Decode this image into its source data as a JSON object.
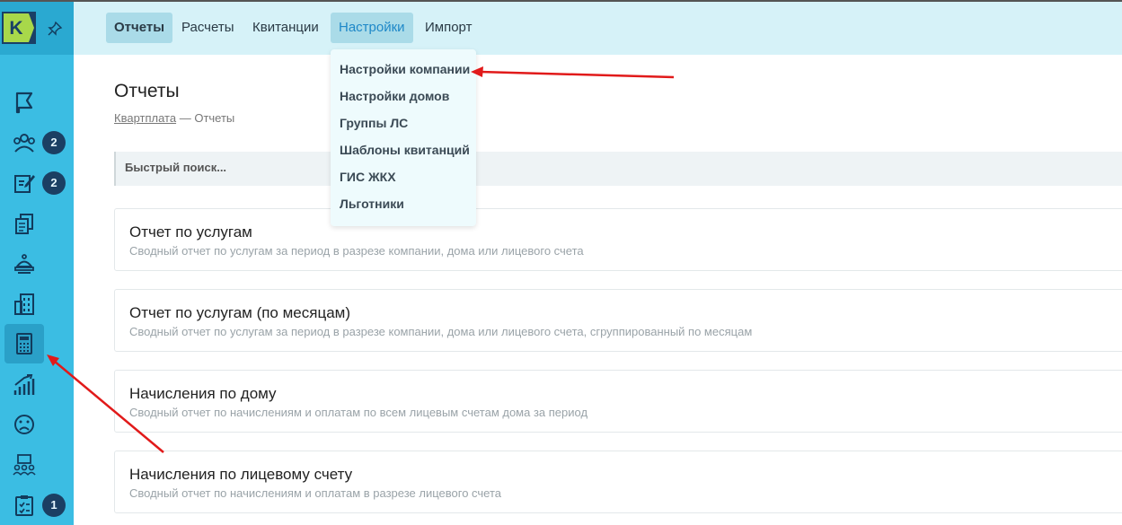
{
  "nav": {
    "tabs": [
      {
        "label": "Отчеты"
      },
      {
        "label": "Расчеты"
      },
      {
        "label": "Квитанции"
      },
      {
        "label": "Настройки"
      },
      {
        "label": "Импорт"
      }
    ],
    "active_tab": "Отчеты",
    "open_menu": "Настройки"
  },
  "dropdown": {
    "items": [
      {
        "label": "Настройки компании"
      },
      {
        "label": "Настройки домов"
      },
      {
        "label": "Группы ЛС"
      },
      {
        "label": "Шаблоны квитанций"
      },
      {
        "label": "ГИС ЖКХ"
      },
      {
        "label": "Льготники"
      }
    ]
  },
  "sidebar": {
    "logo_letter": "K",
    "badges": {
      "residents": "2",
      "requests": "2",
      "tasks": "1"
    },
    "items": [
      {
        "icon": "flag-icon"
      },
      {
        "icon": "residents-icon"
      },
      {
        "icon": "requests-edit-icon"
      },
      {
        "icon": "documents-icon"
      },
      {
        "icon": "service-bell-icon"
      },
      {
        "icon": "buildings-icon"
      },
      {
        "icon": "calculator-icon"
      },
      {
        "icon": "growth-chart-icon"
      },
      {
        "icon": "sad-face-icon"
      },
      {
        "icon": "team-icon"
      },
      {
        "icon": "clipboard-check-icon"
      }
    ]
  },
  "page": {
    "title": "Отчеты",
    "breadcrumb_link": "Квартплата",
    "breadcrumb_sep": "—",
    "breadcrumb_current": "Отчеты",
    "search_placeholder": "Быстрый поиск..."
  },
  "reports": [
    {
      "title": "Отчет по услугам",
      "description": "Сводный отчет по услугам за период в разрезе компании, дома или лицевого счета"
    },
    {
      "title": "Отчет по услугам (по месяцам)",
      "description": "Сводный отчет по услугам за период в разрезе компании, дома или лицевого счета, сгруппированный по месяцам"
    },
    {
      "title": "Начисления по дому",
      "description": "Сводный отчет по начислениям и оплатам по всем лицевым счетам дома за период"
    },
    {
      "title": "Начисления по лицевому счету",
      "description": "Сводный отчет по начислениям и оплатам в разрезе лицевого счета"
    }
  ],
  "colors": {
    "sidebar": "#3bbde3",
    "topnav": "#d6f2f8",
    "badge": "#1b3f63",
    "annotation_arrow": "#e11a1a"
  }
}
